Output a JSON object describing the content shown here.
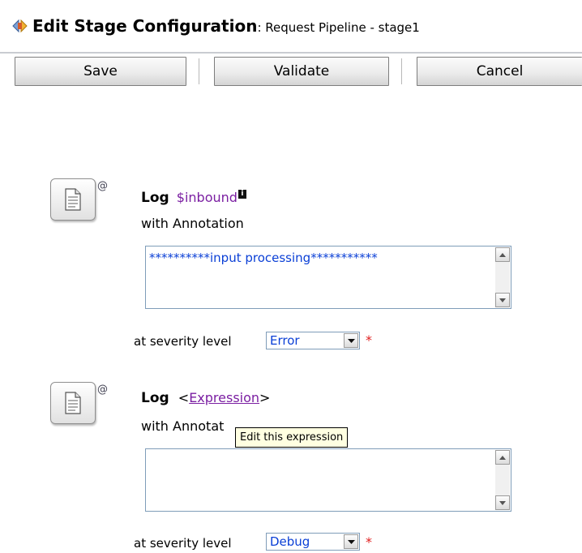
{
  "header": {
    "title": "Edit Stage Configuration",
    "subtitle": " : Request Pipeline - stage1",
    "icon": "stage-config-icon"
  },
  "toolbar": {
    "save_label": "Save",
    "validate_label": "Validate",
    "cancel_label": "Cancel"
  },
  "actions": [
    {
      "icon": "log-action-icon",
      "at_icon": "@",
      "keyword": "Log",
      "variable": "$inbound",
      "annotation_label": "with Annotation",
      "annotation_value": "**********input processing***********",
      "severity_label": "at severity level",
      "severity_value": "Error",
      "required_mark": "*"
    },
    {
      "icon": "log-action-icon",
      "at_icon": "@",
      "keyword": "Log",
      "expr_open": "<",
      "expression_link": "Expression",
      "expr_close": ">",
      "annotation_label": "with Annotat",
      "annotation_value": "",
      "severity_label": "at severity level",
      "severity_value": "Debug",
      "required_mark": "*"
    }
  ],
  "tooltip": "Edit this expression",
  "colors": {
    "link_purple": "#7b1fa2",
    "value_blue": "#0a3fd6",
    "required_red": "#e02020",
    "tooltip_bg": "#ffffe1"
  }
}
